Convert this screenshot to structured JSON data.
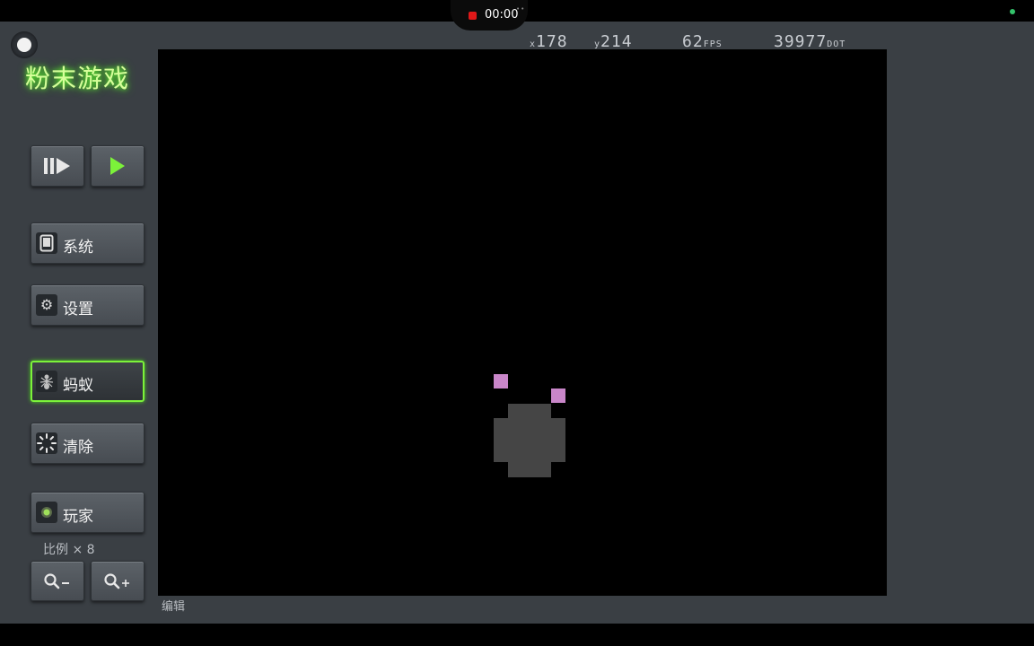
{
  "recording": {
    "time": "00:00"
  },
  "app": {
    "title": "粉末游戏"
  },
  "hud": {
    "x_prefix": "x",
    "x_value": "178",
    "y_prefix": "y",
    "y_value": "214",
    "fps_value": "62",
    "fps_unit": "FPS",
    "dot_value": "39977",
    "dot_unit": "DOT"
  },
  "controls": {
    "step_icon": "step-forward-icon",
    "play_icon": "play-icon"
  },
  "menu": {
    "system_label": "系统",
    "system_icon": "tablet-icon",
    "settings_label": "设置",
    "settings_icon": "gear-icon",
    "ant_label": "蚂蚁",
    "ant_icon": "ant-icon",
    "clear_label": "清除",
    "clear_icon": "burst-icon",
    "player_label": "玩家",
    "player_icon": "player-dot-icon"
  },
  "zoom": {
    "scale_label": "比例 × 8",
    "zoom_out_icon": "zoom-out-icon",
    "zoom_in_icon": "zoom-in-icon"
  },
  "footer": {
    "edit_label": "编辑"
  },
  "colors": {
    "accent_green": "#7cf23a",
    "particle_pink": "#c986c9",
    "player_gray": "#454545",
    "canvas_bg": "#000000"
  }
}
